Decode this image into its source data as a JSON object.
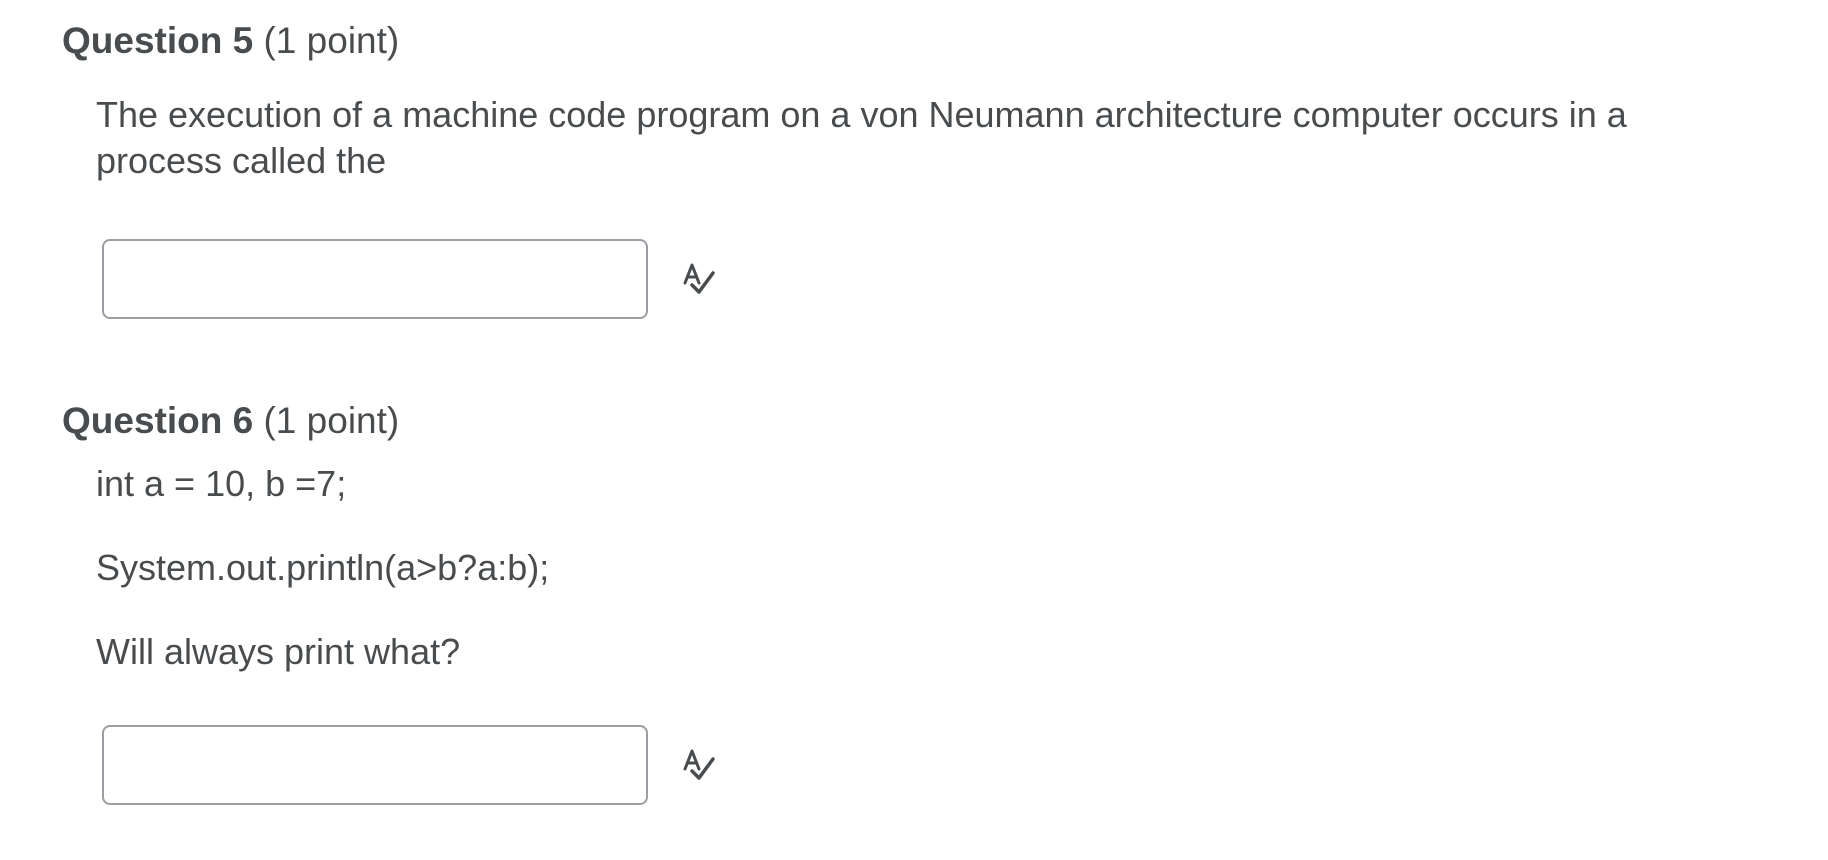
{
  "questions": [
    {
      "name": "Question 5",
      "points": "(1 point)",
      "text": "The execution of a machine code program on a von Neumann architecture computer occurs in a process called the",
      "answer_value": "",
      "spellcheck_icon": "spellcheck-icon"
    },
    {
      "name": "Question 6",
      "points": "(1 point)",
      "lines": [
        "int a = 10, b =7;",
        "System.out.println(a>b?a:b);",
        "Will always print what?"
      ],
      "answer_value": "",
      "spellcheck_icon": "spellcheck-icon"
    }
  ],
  "colors": {
    "text": "#494c4e",
    "input_border": "#9b9ea2",
    "background": "#ffffff"
  }
}
